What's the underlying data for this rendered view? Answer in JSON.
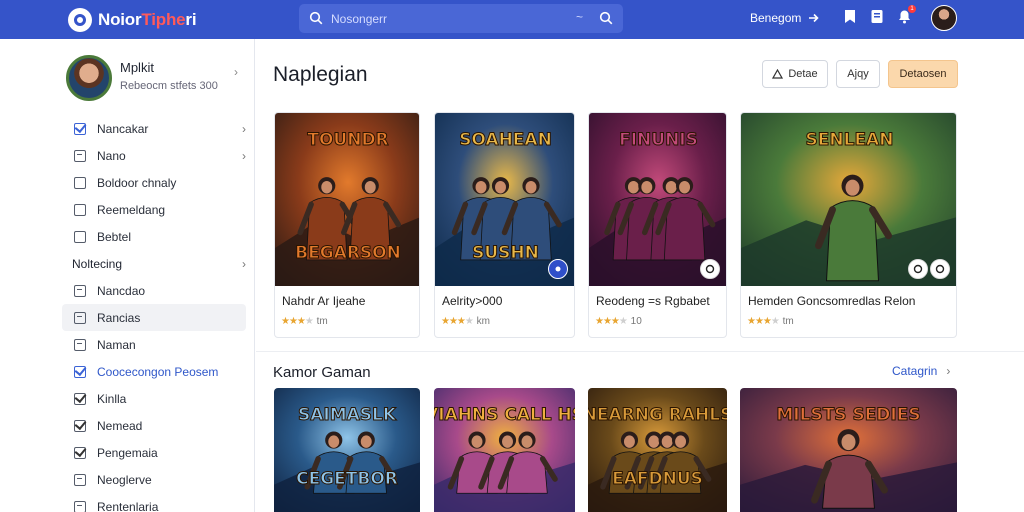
{
  "app": {
    "logo_prefix": "Noior",
    "logo_accent": "Tiphe",
    "logo_suffix": "ri"
  },
  "search": {
    "placeholder": "Nosongerr",
    "tilde": "~"
  },
  "top_link": "Benegom",
  "top_badge": "1",
  "profile": {
    "name": "Mplkit",
    "sub": "Rebeocm stfets 300"
  },
  "nav": [
    {
      "label": "Nancakar",
      "box": "checked",
      "chev": true,
      "blue": false
    },
    {
      "label": "Nano",
      "box": "line",
      "chev": true,
      "blue": false
    },
    {
      "label": "Boldoor chnaly",
      "box": "empty",
      "chev": false,
      "blue": false
    },
    {
      "label": "Reemeldang",
      "box": "empty",
      "chev": false,
      "blue": false
    },
    {
      "label": "Bebtel",
      "box": "empty",
      "chev": false,
      "blue": false
    },
    {
      "label": "Noltecing",
      "box": "none",
      "chev": true,
      "blue": false,
      "head": true
    },
    {
      "label": "Nancdao",
      "box": "line",
      "chev": false,
      "blue": false
    },
    {
      "label": "Rancias",
      "box": "line",
      "chev": false,
      "blue": false,
      "active": true
    },
    {
      "label": "Naman",
      "box": "line",
      "chev": false,
      "blue": false
    },
    {
      "label": "Coocecongon Peosem",
      "box": "checked",
      "chev": false,
      "blue": true
    },
    {
      "label": "Kinlla",
      "box": "dark",
      "chev": false,
      "blue": false
    },
    {
      "label": "Nemead",
      "box": "dark",
      "chev": false,
      "blue": false
    },
    {
      "label": "Pengemaia",
      "box": "dark",
      "chev": false,
      "blue": false
    },
    {
      "label": "Neoglerve",
      "box": "line",
      "chev": false,
      "blue": false
    },
    {
      "label": "Rentenlaria",
      "box": "line",
      "chev": false,
      "blue": false
    }
  ],
  "section1": {
    "title": "Naplegian",
    "actions": [
      "Detae",
      "Ajqy",
      "Detaosen"
    ]
  },
  "games": [
    {
      "title": "Nahdr Ar Ijeahe",
      "rating_text": "tm",
      "art_top": "TOUNDR",
      "art_bottom": "BEGARSON",
      "colors": [
        "#2a1a14",
        "#8a3b1a",
        "#e27a2c"
      ]
    },
    {
      "title": "Aelrity>000",
      "rating_text": "km",
      "art_top": "SOAHEAN",
      "art_bottom": "SUSHN",
      "colors": [
        "#0e2a4a",
        "#2e4d7a",
        "#e8b84a"
      ]
    },
    {
      "title": "Reodeng =s Rgbabet",
      "rating_text": "10",
      "art_top": "FINUNIS",
      "art_bottom": "",
      "colors": [
        "#2a0f2a",
        "#6a1f4a",
        "#c24a7a"
      ]
    },
    {
      "title": "Hemden Goncsomredlas Relon",
      "rating_text": "tm",
      "art_top": "SENLEAN",
      "art_bottom": "",
      "colors": [
        "#1d3a2a",
        "#4a7a3a",
        "#e6a83a"
      ]
    }
  ],
  "section2": {
    "title": "Kamor Gaman",
    "see_all": "Catagrin"
  },
  "games2": [
    {
      "art_top": "SAIMASLK",
      "art_bottom": "CEGETBOR",
      "colors": [
        "#0f2240",
        "#2a5a8a",
        "#8fc4e8"
      ]
    },
    {
      "art_top": "VIAHNS CALL HS",
      "art_bottom": "",
      "colors": [
        "#3a2a6a",
        "#a84a8a",
        "#f0b040"
      ]
    },
    {
      "art_top": "NEARNG RAHLS",
      "art_bottom": "EAFDNUS",
      "colors": [
        "#2a1a0e",
        "#6a4a1a",
        "#d89a3a"
      ]
    },
    {
      "art_top": "MILSTS SEDIES",
      "art_bottom": "",
      "colors": [
        "#2a1a3a",
        "#7a3a4a",
        "#e0703a"
      ]
    }
  ]
}
